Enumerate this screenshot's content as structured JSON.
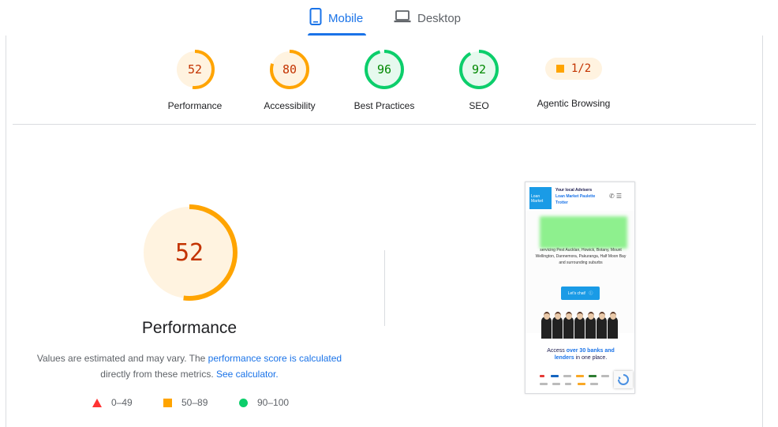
{
  "tabs": [
    {
      "label": "Mobile",
      "icon": "mobile-phone-icon",
      "active": true
    },
    {
      "label": "Desktop",
      "icon": "laptop-icon",
      "active": false
    }
  ],
  "colors": {
    "accent": "#1a73e8",
    "fail": "#ff3333",
    "average": "#ffa400",
    "pass": "#0cce6b",
    "average_text": "#c33300",
    "pass_text": "#008800"
  },
  "gauges": [
    {
      "score": "52",
      "label": "Performance",
      "status": "average"
    },
    {
      "score": "80",
      "label": "Accessibility",
      "status": "average"
    },
    {
      "score": "96",
      "label": "Best Practices",
      "status": "pass"
    },
    {
      "score": "92",
      "label": "SEO",
      "status": "pass"
    }
  ],
  "agentic": {
    "value": "1/2",
    "label": "Agentic Browsing"
  },
  "performance": {
    "score": "52",
    "title": "Performance",
    "desc_prefix": "Values are estimated and may vary. The ",
    "desc_link": "performance score is calculated",
    "desc_middle": "directly from these metrics. ",
    "desc_link2": "See calculator."
  },
  "legend": [
    {
      "range": "0–49",
      "shape": "triangle"
    },
    {
      "range": "50–89",
      "shape": "square"
    },
    {
      "range": "90–100",
      "shape": "circle"
    }
  ],
  "thumbnail": {
    "logo": "Loan Market",
    "head_line1": "Your local Advisers",
    "head_line2": "Loan Market Paulette",
    "head_line3": "Trotter",
    "body_text": "servicing Pest Aucklan, Howick, Botany, Mount Wellington, Dannemora, Pakuranga, Half Moon Bay and surrounding suburbs",
    "button": "Let's chat!",
    "access_prefix": "Access ",
    "access_bold": "over 30 banks and lenders",
    "access_suffix": " in one place."
  }
}
